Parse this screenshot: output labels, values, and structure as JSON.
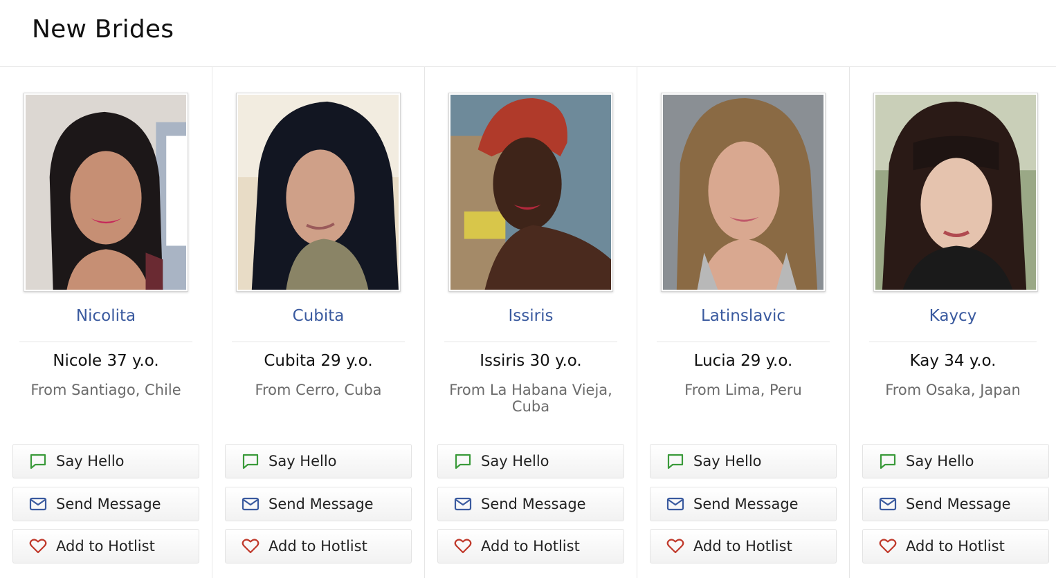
{
  "section_title": "New Brides",
  "buttons": {
    "say_hello": "Say Hello",
    "send_message": "Send Message",
    "add_hotlist": "Add to Hotlist"
  },
  "icons": {
    "say_hello": "chat-bubble-icon",
    "send_message": "envelope-icon",
    "add_hotlist": "heart-icon"
  },
  "colors": {
    "link": "#3a5a9f",
    "chat_icon": "#3a9a3a",
    "mail_icon": "#3a5a9f",
    "heart_icon": "#c0392b"
  },
  "profiles": [
    {
      "username": "Nicolita",
      "name_age": "Nicole 37 y.o.",
      "location": "From Santiago, Chile"
    },
    {
      "username": "Cubita",
      "name_age": "Cubita 29 y.o.",
      "location": "From Cerro, Cuba"
    },
    {
      "username": "Issiris",
      "name_age": "Issiris 30 y.o.",
      "location": "From La Habana Vieja, Cuba"
    },
    {
      "username": "Latinslavic",
      "name_age": "Lucia 29 y.o.",
      "location": "From Lima, Peru"
    },
    {
      "username": "Kaycy",
      "name_age": "Kay 34 y.o.",
      "location": "From Osaka, Japan"
    }
  ]
}
